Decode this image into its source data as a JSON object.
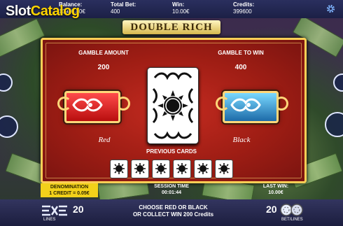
{
  "brand": {
    "logo_part1": "Slot",
    "logo_part2": "Catalog"
  },
  "top_bar": {
    "balance_label": "Balance:",
    "balance_value": "10980.00€",
    "total_bet_label": "Total Bet:",
    "total_bet_value": "400",
    "win_label": "Win:",
    "win_value": "10.00€",
    "credits_label": "Credits:",
    "credits_value": "399600",
    "settings_icon": "gear-icon"
  },
  "game": {
    "title": "DOUBLE RICH"
  },
  "gamble": {
    "amount_label": "GAMBLE AMOUNT",
    "amount_value": "200",
    "to_win_label": "GAMBLE TO WIN",
    "to_win_value": "400",
    "red_label": "Red",
    "black_label": "Black",
    "previous_cards_label": "PREVIOUS CARDS",
    "previous_cards": [
      "sun",
      "sun",
      "sun",
      "sun",
      "sun",
      "sun"
    ],
    "red_color": "#d81b1b",
    "black_color": "#2a8bd0"
  },
  "status": {
    "denomination_label": "DENOMINATION",
    "denomination_value": "1 CREDIT = 0.05€",
    "session_time_label": "SESSION TIME",
    "session_time_value": "00:01:44",
    "last_win_label": "LAST WIN:",
    "last_win_value": "10.00€"
  },
  "bottom_bar": {
    "lines_value": "20",
    "lines_label": "LINES",
    "message_line1": "CHOOSE RED OR BLACK",
    "message_line2": "OR COLLECT WIN 200 Credits",
    "bet_lines_value": "20",
    "bet_lines_label": "BET/LINES"
  }
}
